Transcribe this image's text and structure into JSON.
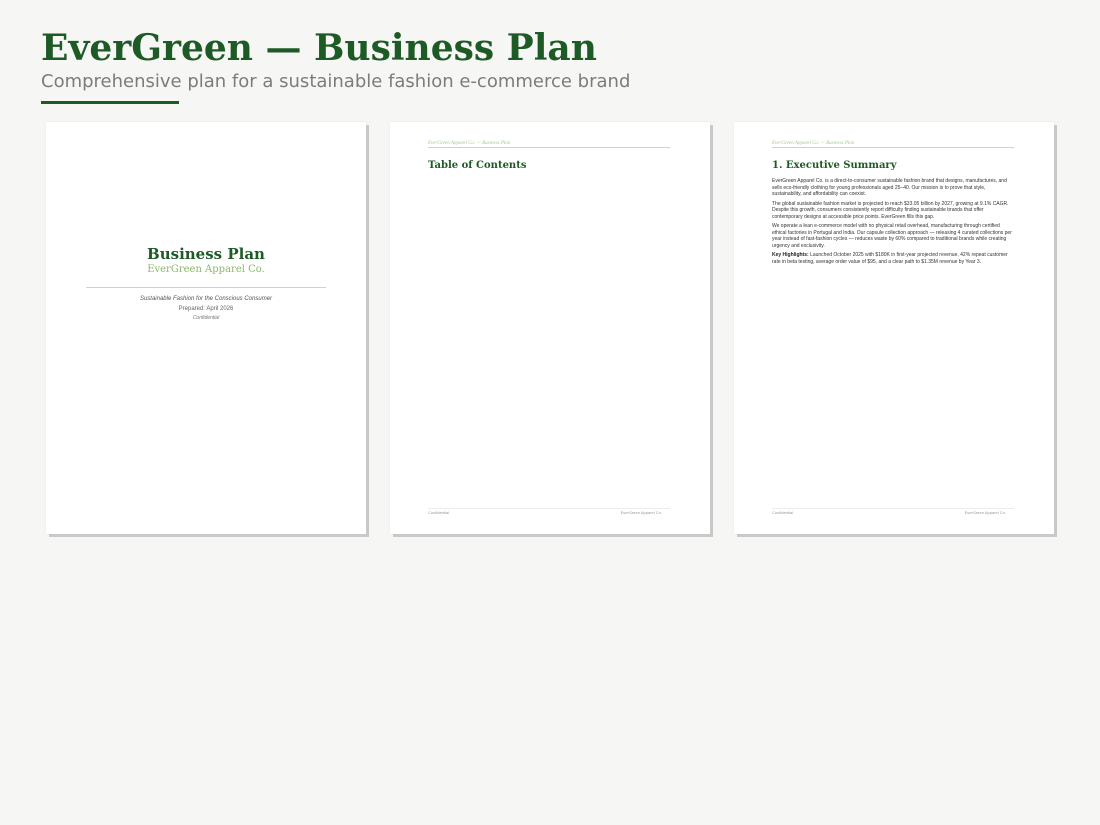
{
  "header": {
    "title": "EverGreen — Business Plan",
    "subtitle": "Comprehensive plan for a sustainable fashion e-commerce brand"
  },
  "colors": {
    "brand_dark_green": "#1e5a26",
    "accent_light_green": "#8db86a",
    "subtitle_gray": "#7c7c7c",
    "background": "#f6f6f4"
  },
  "cover": {
    "title": "Business Plan",
    "company": "EverGreen Apparel Co.",
    "tagline": "Sustainable Fashion for the Conscious Consumer",
    "prepared": "Prepared: April 2026",
    "confidential": "Confidential"
  },
  "running_header": "EverGreen Apparel Co. — Business Plan",
  "footer": {
    "left": "Confidential",
    "right": "EverGreen Apparel Co."
  },
  "toc": {
    "heading": "Table of Contents"
  },
  "exec_summary": {
    "heading": "1. Executive Summary",
    "p1": "EverGreen Apparel Co. is a direct-to-consumer sustainable fashion brand that designs, manufactures, and sells eco-friendly clothing for young professionals aged 25–40. Our mission is to prove that style, sustainability, and affordability can coexist.",
    "p2": "The global sustainable fashion market is projected to reach $33.05 billion by 2027, growing at 9.1% CAGR. Despite this growth, consumers consistently report difficulty finding sustainable brands that offer contemporary designs at accessible price points. EverGreen fills this gap.",
    "p3": "We operate a lean e-commerce model with no physical retail overhead, manufacturing through certified ethical factories in Portugal and India. Our capsule collection approach — releasing 4 curated collections per year instead of fast-fashion cycles — reduces waste by 60% compared to traditional brands while creating urgency and exclusivity.",
    "p4_label": "Key Highlights:",
    "p4": " Launched October 2025 with $180K in first-year projected revenue, 42% repeat customer rate in beta testing, average order value of $95, and a clear path to $1.35M revenue by Year 3."
  }
}
